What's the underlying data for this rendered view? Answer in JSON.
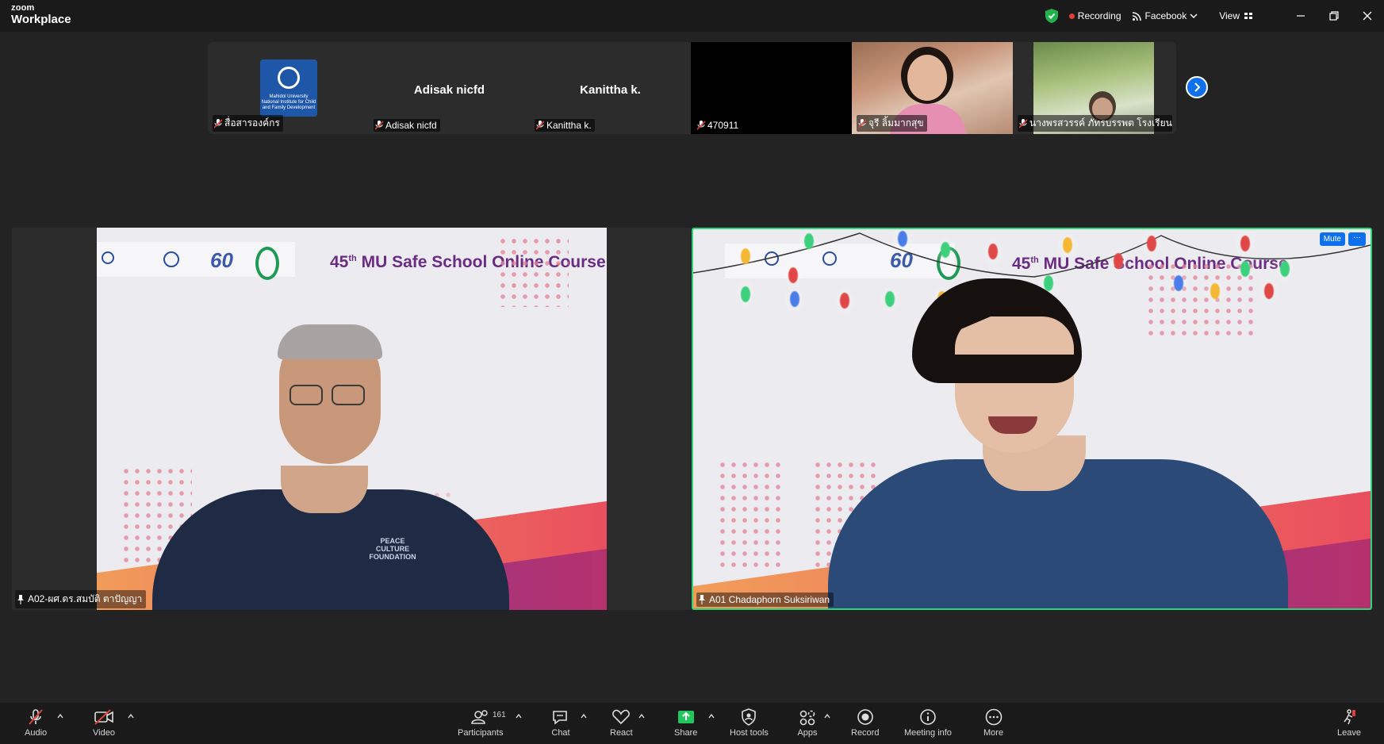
{
  "app": {
    "brand_top": "zoom",
    "brand_bottom": "Workplace"
  },
  "titlebar": {
    "recording": "Recording",
    "stream": "Facebook",
    "view": "View",
    "colors": {
      "secure": "#22b14c",
      "record_dot": "#e0403b"
    }
  },
  "thumbnails": [
    {
      "name": "สื่อสารองค์กร",
      "display": "",
      "type": "logo",
      "logo_text": "Mahidol University National Institute for Child and Family Development"
    },
    {
      "name": "Adisak nicfd",
      "display": "Adisak nicfd",
      "type": "name"
    },
    {
      "name": "Kanittha k.",
      "display": "Kanittha k.",
      "type": "name"
    },
    {
      "name": "470911",
      "display": "",
      "type": "black"
    },
    {
      "name": "จุรี ลิ้มมากสุข",
      "display": "",
      "type": "video"
    },
    {
      "name": "นางพรสวรรค์ ภัทรบรรพต โรงเรียนสร...",
      "display": "",
      "type": "video"
    }
  ],
  "tiles": [
    {
      "name": "A02-ผศ.ดร.สมบัติ ตาปัญญา",
      "slide_title": "45",
      "slide_title_sup": "th",
      "slide_title_rest": " MU Safe School Online Course",
      "logo_60": "60",
      "shirt_text": "PEACE CULTURE FOUNDATION"
    },
    {
      "name": "A01 Chadaphorn Suksiriwan",
      "slide_title": "45",
      "slide_title_sup": "th",
      "slide_title_rest": " MU Safe School Online Course",
      "logo_60": "60",
      "mute_label": "Mute",
      "more_label": "···",
      "active_speaker_color": "#2ed47a"
    }
  ],
  "toolbar": {
    "audio": "Audio",
    "video": "Video",
    "participants": "Participants",
    "participants_count": "161",
    "chat": "Chat",
    "react": "React",
    "share": "Share",
    "host_tools": "Host tools",
    "apps": "Apps",
    "record": "Record",
    "meeting_info": "Meeting info",
    "more": "More",
    "leave": "Leave",
    "colors": {
      "share": "#22c55e",
      "muted": "#e0403b"
    }
  }
}
